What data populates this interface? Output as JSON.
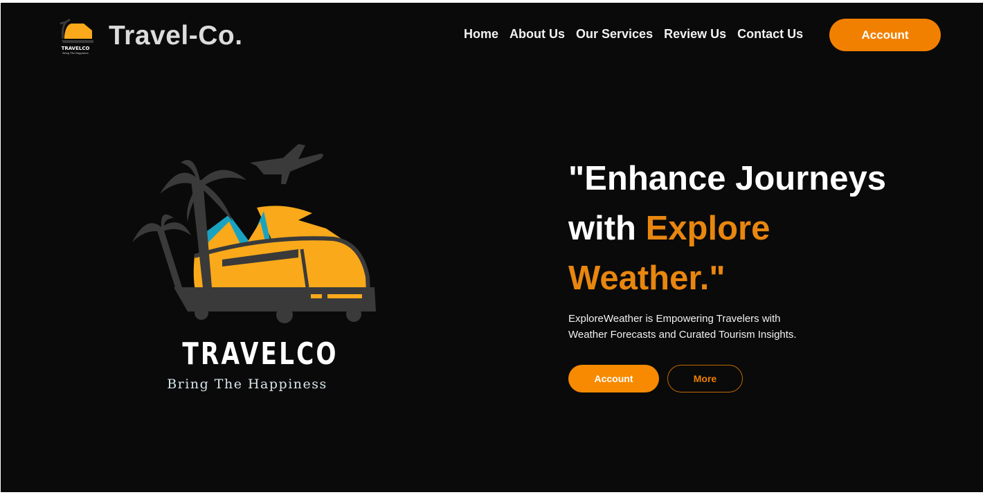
{
  "header": {
    "brand_name": "Travel-Co.",
    "logo_text": "TRAVELCO",
    "logo_tagline": "Bring The Happiness",
    "nav": [
      {
        "label": "Home"
      },
      {
        "label": "About Us"
      },
      {
        "label": "Our Services"
      },
      {
        "label": "Review Us"
      },
      {
        "label": "Contact Us"
      }
    ],
    "account_label": "Account"
  },
  "hero": {
    "logo_word": "TRAVELCO",
    "logo_tagline": "Bring The Happiness",
    "headline_part1": "\"Enhance Journeys",
    "headline_part2": "with ",
    "headline_accent1": "Explore",
    "headline_accent2": "Weather.\"",
    "description_line1": "ExploreWeather is Empowering Travelers with",
    "description_line2": "Weather Forecasts and Curated Tourism Insights.",
    "primary_button": "Account",
    "secondary_button": "More"
  },
  "colors": {
    "accent": "#f28000",
    "background": "#0a0a0a",
    "logo_yellow": "#f9a91a",
    "logo_teal": "#1aa3c0",
    "logo_gray": "#3a3a3a"
  }
}
